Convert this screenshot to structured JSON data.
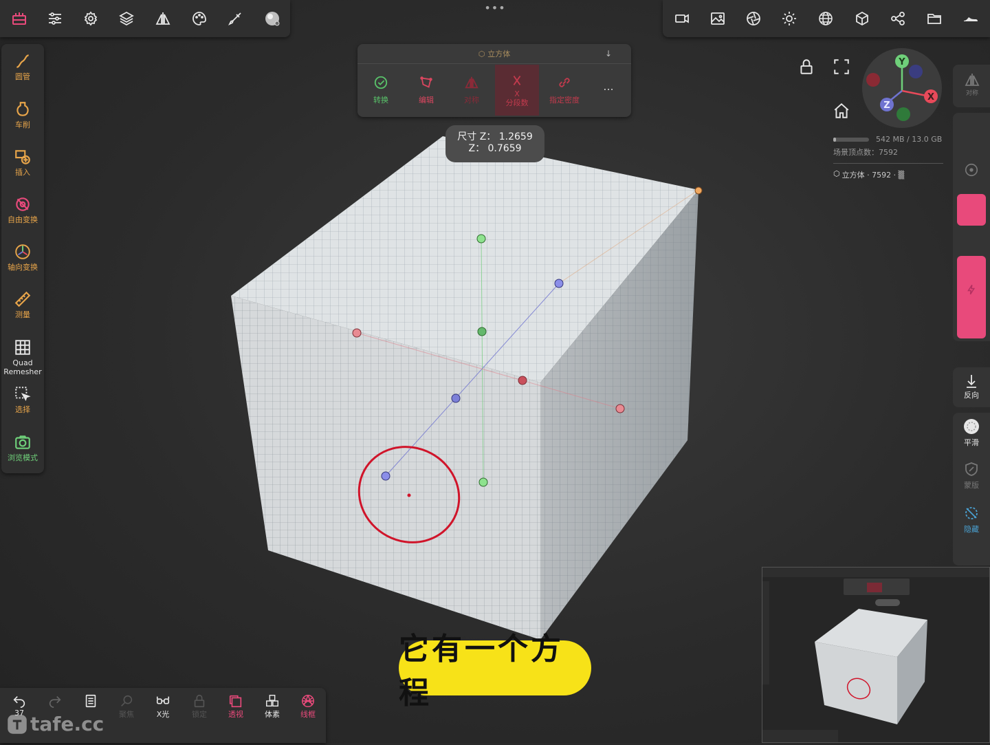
{
  "top_left_toolbar": {
    "icons": [
      "scene-icon",
      "sliders-icon",
      "gear-icon",
      "layers-icon",
      "symmetry-icon",
      "palette-icon",
      "brush-icon",
      "material-sphere-icon"
    ]
  },
  "top_center": {
    "handle": "•••"
  },
  "top_right_toolbar": {
    "icons": [
      "camera-icon",
      "image-icon",
      "aperture-icon",
      "sun-icon",
      "sphere-grid-icon",
      "cube-icon",
      "nodes-icon",
      "folder-icon",
      "shoe-icon"
    ]
  },
  "left_tools": [
    {
      "name": "tube",
      "label": "圆管",
      "icon": "tube-icon"
    },
    {
      "name": "lathe",
      "label": "车削",
      "icon": "vase-icon"
    },
    {
      "name": "insert",
      "label": "插入",
      "icon": "insert-shape-icon"
    },
    {
      "name": "free-transform",
      "label": "自由变换",
      "icon": "free-transform-icon"
    },
    {
      "name": "axis-transform",
      "label": "轴向变换",
      "icon": "gizmo-icon"
    },
    {
      "name": "measure",
      "label": "测量",
      "icon": "ruler-icon"
    },
    {
      "name": "quad-remesher",
      "label": "Quad\nRemesher",
      "icon": "grid-icon"
    },
    {
      "name": "select",
      "label": "选择",
      "icon": "select-icon"
    },
    {
      "name": "view-mode",
      "label": "浏览模式",
      "icon": "camera-icon"
    }
  ],
  "float_menu": {
    "title": "立方体",
    "items": [
      {
        "label": "转换",
        "icon": "check-circle-icon",
        "color": "#59c36a"
      },
      {
        "label": "编辑",
        "icon": "edit-shape-icon",
        "color": "#d9465f"
      },
      {
        "label": "对称",
        "icon": "mirror-icon",
        "color": "#8a2a38"
      },
      {
        "label": "X\n分段数",
        "icon": "division-icon",
        "color": "#c23a4d"
      },
      {
        "label": "指定密度",
        "icon": "link-icon",
        "color": "#c23a4d"
      }
    ],
    "more": "..."
  },
  "dimension_tooltip": {
    "line1": "尺寸 Z： 1.2659",
    "line2": "Z： 0.7659"
  },
  "scene_info": {
    "memory": "542 MB / 13.0 GB",
    "vertices": "场景顶点数：7592",
    "object": "立方体 · 7592 · ▒"
  },
  "gizmo_axes": {
    "y": "Y",
    "x": "X",
    "z": "Z"
  },
  "right_panel": {
    "top_label": "对称",
    "reverse_label": "反向",
    "smooth_label": "平滑",
    "mask_label": "蒙版",
    "hide_label": "隐藏"
  },
  "bottom_bar": [
    {
      "label": "37",
      "icon": "undo-icon"
    },
    {
      "label": "",
      "icon": "redo-icon"
    },
    {
      "label": "",
      "icon": "book-icon"
    },
    {
      "label": "聚焦",
      "icon": "search-icon"
    },
    {
      "label": "X光",
      "icon": "glasses-icon"
    },
    {
      "label": "锁定",
      "icon": "lock-icon"
    },
    {
      "label": "透视",
      "icon": "perspective-icon"
    },
    {
      "label": "体素",
      "icon": "voxel-icon"
    },
    {
      "label": "线框",
      "icon": "wireframe-icon"
    }
  ],
  "watermark": "tafe.cc",
  "caption": "它有一个方程",
  "colors": {
    "accent_pink": "#e84a7b",
    "accent_orange": "#e8a54a",
    "accent_green": "#6fd07a",
    "caption_bg": "#f7e218"
  }
}
